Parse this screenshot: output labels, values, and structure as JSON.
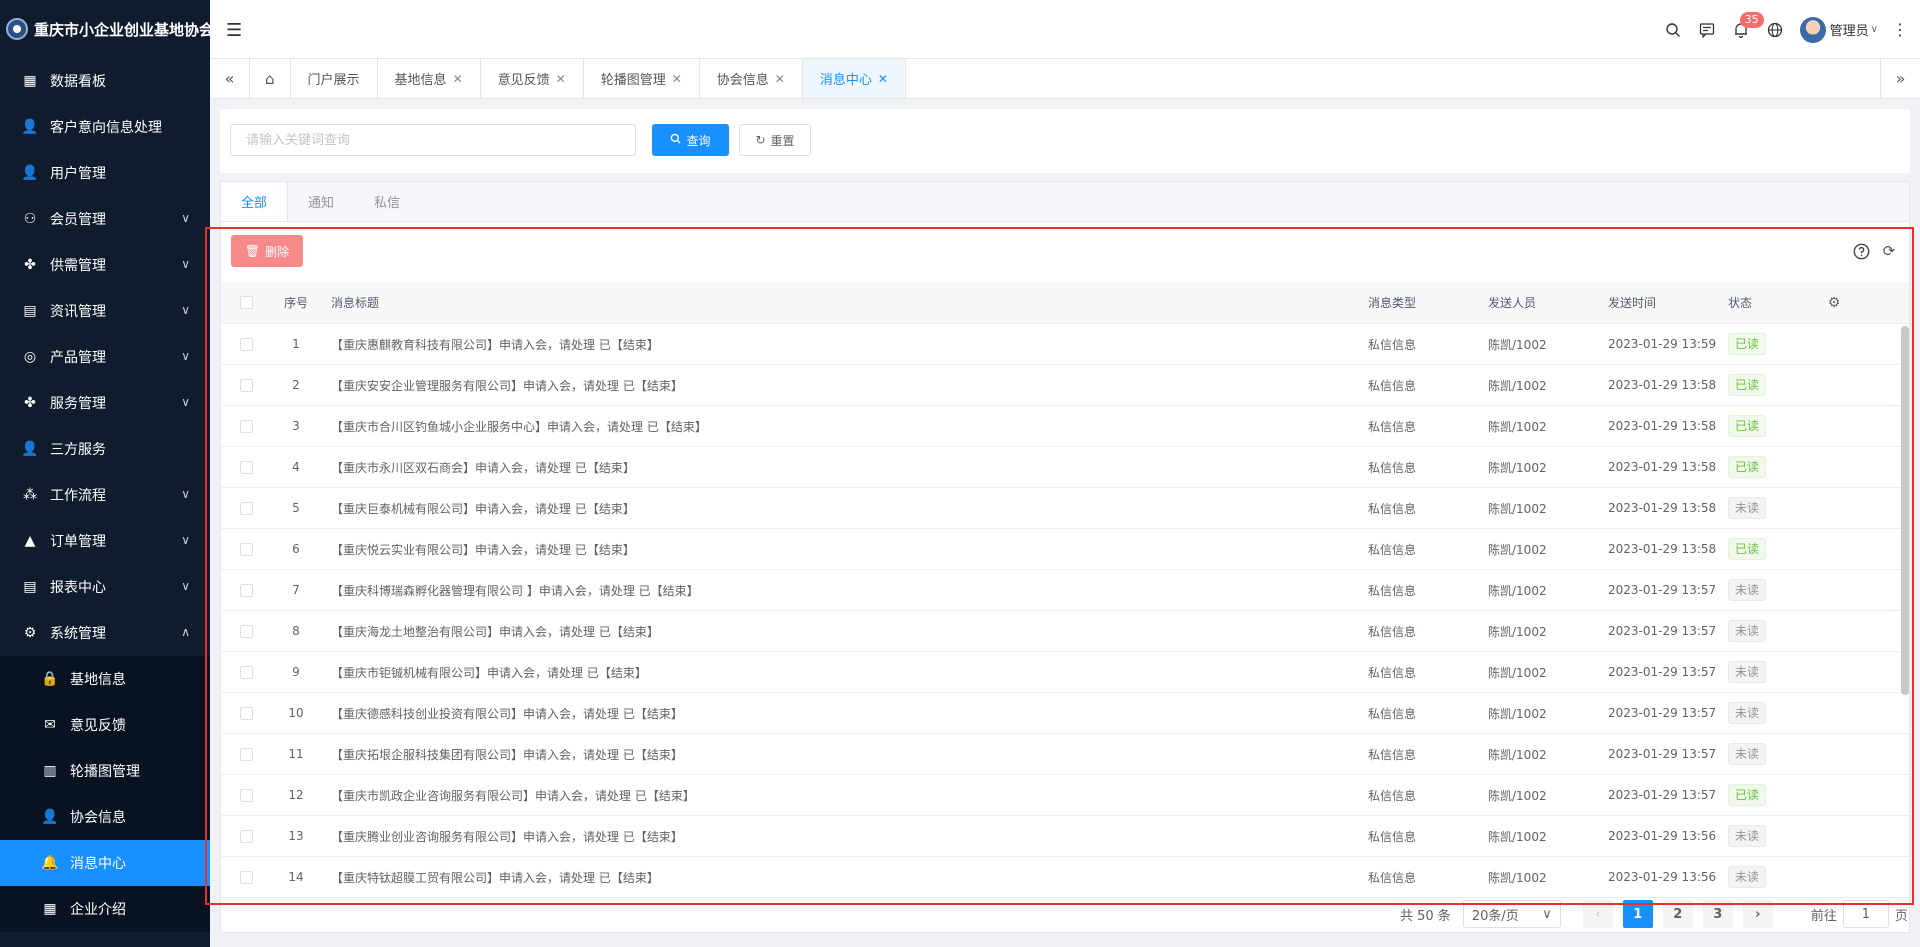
{
  "app": {
    "title": "重庆市小企业创业基地协会"
  },
  "sidebar": {
    "items": [
      {
        "label": "数据看板",
        "icon": "dashboard-icon",
        "glyph": "▦",
        "has_arrow": false
      },
      {
        "label": "客户意向信息处理",
        "icon": "customer-icon",
        "glyph": "👤",
        "has_arrow": false
      },
      {
        "label": "用户管理",
        "icon": "user-icon",
        "glyph": "👤",
        "has_arrow": false
      },
      {
        "label": "会员管理",
        "icon": "member-icon",
        "glyph": "⚇",
        "has_arrow": true
      },
      {
        "label": "供需管理",
        "icon": "supply-icon",
        "glyph": "✤",
        "has_arrow": true
      },
      {
        "label": "资讯管理",
        "icon": "news-icon",
        "glyph": "▤",
        "has_arrow": true
      },
      {
        "label": "产品管理",
        "icon": "product-icon",
        "glyph": "◎",
        "has_arrow": true
      },
      {
        "label": "服务管理",
        "icon": "service-icon",
        "glyph": "✤",
        "has_arrow": true
      },
      {
        "label": "三方服务",
        "icon": "third-party-icon",
        "glyph": "👤",
        "has_arrow": false
      },
      {
        "label": "工作流程",
        "icon": "workflow-icon",
        "glyph": "⁂",
        "has_arrow": true
      },
      {
        "label": "订单管理",
        "icon": "order-icon",
        "glyph": "▲",
        "has_arrow": true
      },
      {
        "label": "报表中心",
        "icon": "report-icon",
        "glyph": "▤",
        "has_arrow": true
      },
      {
        "label": "系统管理",
        "icon": "settings-icon",
        "glyph": "⚙",
        "has_arrow": true,
        "expanded": true
      }
    ],
    "sub_items": [
      {
        "label": "基地信息",
        "icon": "lock-icon",
        "glyph": "🔒"
      },
      {
        "label": "意见反馈",
        "icon": "mail-icon",
        "glyph": "✉"
      },
      {
        "label": "轮播图管理",
        "icon": "map-icon",
        "glyph": "▥"
      },
      {
        "label": "协会信息",
        "icon": "user-group-icon",
        "glyph": "👤"
      },
      {
        "label": "消息中心",
        "icon": "bell-icon",
        "glyph": "🔔",
        "active": true
      },
      {
        "label": "企业介绍",
        "icon": "table-icon",
        "glyph": "▦"
      }
    ]
  },
  "header": {
    "notification_count": "35",
    "user_name": "管理员"
  },
  "tabs": [
    {
      "label": "门户展示",
      "closable": false
    },
    {
      "label": "基地信息",
      "closable": true
    },
    {
      "label": "意见反馈",
      "closable": true
    },
    {
      "label": "轮播图管理",
      "closable": true
    },
    {
      "label": "协会信息",
      "closable": true
    },
    {
      "label": "消息中心",
      "closable": true,
      "active": true
    }
  ],
  "search": {
    "placeholder": "请输入关键词查询",
    "value": "",
    "query_label": "查询",
    "reset_label": "重置"
  },
  "message_tabs": [
    {
      "label": "全部",
      "active": true
    },
    {
      "label": "通知"
    },
    {
      "label": "私信"
    }
  ],
  "toolbar": {
    "delete_label": "删除"
  },
  "table": {
    "columns": [
      "序号",
      "消息标题",
      "消息类型",
      "发送人员",
      "发送时间",
      "状态"
    ],
    "rows": [
      {
        "idx": "1",
        "title": "【重庆惠麒教育科技有限公司】申请入会，请处理 已【结束】",
        "type": "私信信息",
        "sender": "陈凯/1002",
        "time": "2023-01-29 13:59",
        "status": "已读"
      },
      {
        "idx": "2",
        "title": "【重庆安安企业管理服务有限公司】申请入会，请处理 已【结束】",
        "type": "私信信息",
        "sender": "陈凯/1002",
        "time": "2023-01-29 13:58",
        "status": "已读"
      },
      {
        "idx": "3",
        "title": "【重庆市合川区钓鱼城小企业服务中心】申请入会，请处理 已【结束】",
        "type": "私信信息",
        "sender": "陈凯/1002",
        "time": "2023-01-29 13:58",
        "status": "已读"
      },
      {
        "idx": "4",
        "title": "【重庆市永川区双石商会】申请入会，请处理 已【结束】",
        "type": "私信信息",
        "sender": "陈凯/1002",
        "time": "2023-01-29 13:58",
        "status": "已读"
      },
      {
        "idx": "5",
        "title": "【重庆巨泰机械有限公司】申请入会，请处理 已【结束】",
        "type": "私信信息",
        "sender": "陈凯/1002",
        "time": "2023-01-29 13:58",
        "status": "未读"
      },
      {
        "idx": "6",
        "title": "【重庆悦云实业有限公司】申请入会，请处理 已【结束】",
        "type": "私信信息",
        "sender": "陈凯/1002",
        "time": "2023-01-29 13:58",
        "status": "已读"
      },
      {
        "idx": "7",
        "title": "【重庆科博瑞森孵化器管理有限公司 】申请入会，请处理 已【结束】",
        "type": "私信信息",
        "sender": "陈凯/1002",
        "time": "2023-01-29 13:57",
        "status": "未读"
      },
      {
        "idx": "8",
        "title": "【重庆海龙土地整治有限公司】申请入会，请处理 已【结束】",
        "type": "私信信息",
        "sender": "陈凯/1002",
        "time": "2023-01-29 13:57",
        "status": "未读"
      },
      {
        "idx": "9",
        "title": "【重庆市钜铖机械有限公司】申请入会，请处理 已【结束】",
        "type": "私信信息",
        "sender": "陈凯/1002",
        "time": "2023-01-29 13:57",
        "status": "未读"
      },
      {
        "idx": "10",
        "title": "【重庆德感科技创业投资有限公司】申请入会，请处理 已【结束】",
        "type": "私信信息",
        "sender": "陈凯/1002",
        "time": "2023-01-29 13:57",
        "status": "未读"
      },
      {
        "idx": "11",
        "title": "【重庆拓垠企服科技集团有限公司】申请入会，请处理 已【结束】",
        "type": "私信信息",
        "sender": "陈凯/1002",
        "time": "2023-01-29 13:57",
        "status": "未读"
      },
      {
        "idx": "12",
        "title": "【重庆市凯政企业咨询服务有限公司】申请入会，请处理 已【结束】",
        "type": "私信信息",
        "sender": "陈凯/1002",
        "time": "2023-01-29 13:57",
        "status": "已读"
      },
      {
        "idx": "13",
        "title": "【重庆腾业创业咨询服务有限公司】申请入会，请处理 已【结束】",
        "type": "私信信息",
        "sender": "陈凯/1002",
        "time": "2023-01-29 13:56",
        "status": "未读"
      },
      {
        "idx": "14",
        "title": "【重庆特钛超膜工贸有限公司】申请入会，请处理 已【结束】",
        "type": "私信信息",
        "sender": "陈凯/1002",
        "time": "2023-01-29 13:56",
        "status": "未读"
      }
    ]
  },
  "pagination": {
    "total_label": "共 50 条",
    "page_size_label": "20条/页",
    "pages": [
      "1",
      "2",
      "3"
    ],
    "current_page": "1",
    "goto_label": "前往",
    "goto_value": "1",
    "page_suffix": "页"
  },
  "colors": {
    "primary": "#1890ff",
    "sidebar_bg": "#0f1c2e",
    "danger": "#f78989",
    "read": "#67c23a",
    "highlight_frame": "#e8302a"
  }
}
